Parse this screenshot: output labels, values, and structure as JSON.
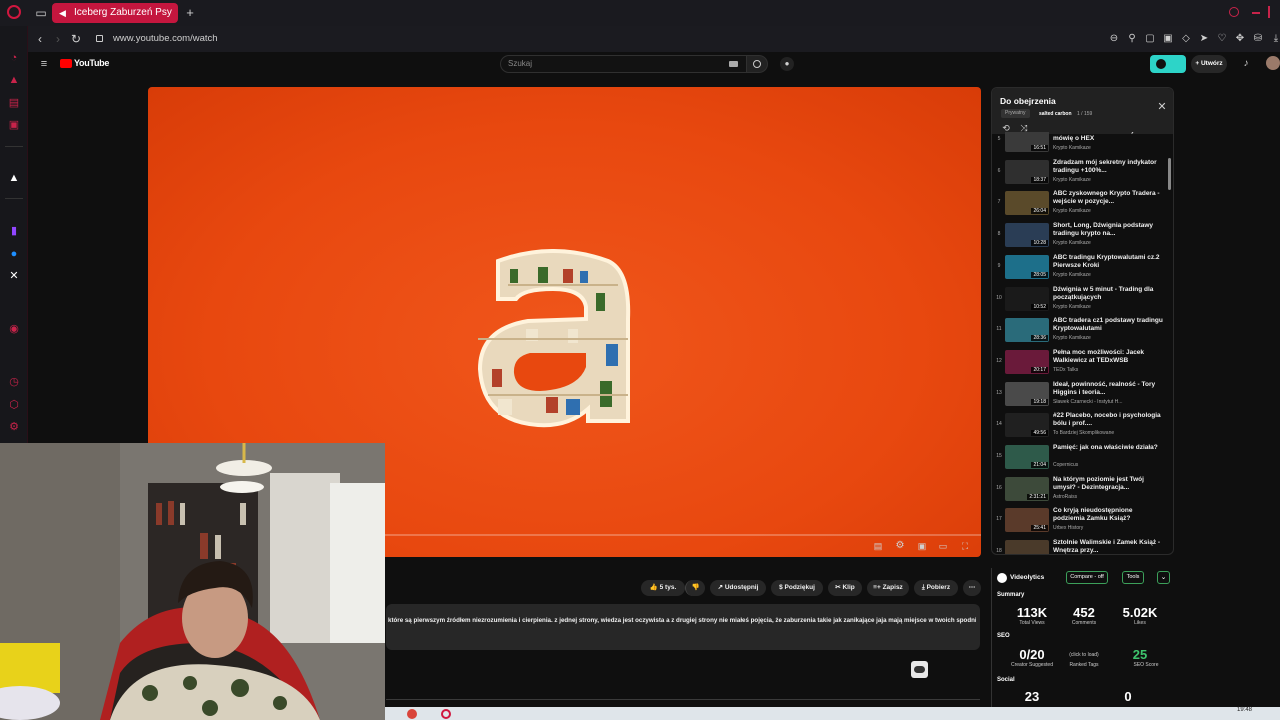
{
  "browser": {
    "tab_title": "Iceberg Zaburzeń Psy",
    "url": "www.youtube.com/watch"
  },
  "youtube": {
    "logo_text": "YouTube",
    "search_placeholder": "Szukaj",
    "create_label": "Utwórz"
  },
  "video": {
    "progress_fraction": 0.23
  },
  "playlist": {
    "title": "Do obejrzenia",
    "privacy": "Prywatny",
    "owner": "salted carbon",
    "position": "1 / 159",
    "items": [
      {
        "num": "5",
        "title": "Mało kto wie o HEX a duży film mówię o HEX",
        "channel": "Krypto Kamikaze",
        "duration": "16:51",
        "color": "#3a3a3a"
      },
      {
        "num": "6",
        "title": "Zdradzam mój sekretny indykator tradingu +100%...",
        "channel": "Krypto Kamikaze",
        "duration": "18:37",
        "color": "#2f2f2f"
      },
      {
        "num": "7",
        "title": "ABC zyskownego Krypto Tradera - wejście w pozycje...",
        "channel": "Krypto Kamikaze",
        "duration": "26:04",
        "color": "#5a4a2a"
      },
      {
        "num": "8",
        "title": "Short, Long, Dźwignia podstawy tradingu krypto na...",
        "channel": "Krypto Kamikaze",
        "duration": "10:28",
        "color": "#2a3d55"
      },
      {
        "num": "9",
        "title": "ABC tradingu Kryptowalutami cz.2 Pierwsze Kroki",
        "channel": "Krypto Kamikaze",
        "duration": "28:05",
        "color": "#1d6f8a"
      },
      {
        "num": "10",
        "title": "Dźwignia w 5 minut - Trading dla początkujących",
        "channel": "Krypto Kamikaze",
        "duration": "10:52",
        "color": "#1a1a1a"
      },
      {
        "num": "11",
        "title": "ABC tradera cz1 podstawy tradingu Kryptowalutami",
        "channel": "Krypto Kamikaze",
        "duration": "28:36",
        "color": "#2a6b7a"
      },
      {
        "num": "12",
        "title": "Pełna moc możliwości: Jacek Walkiewicz at TEDxWSB",
        "channel": "TEDx Talks",
        "duration": "20:17",
        "color": "#6a1a3a"
      },
      {
        "num": "13",
        "title": "Ideał, powinność, realność - Tory Higgins i teoria...",
        "channel": "Sławek Czarnecki - Instytut H...",
        "duration": "19:18",
        "color": "#4a4a4a"
      },
      {
        "num": "14",
        "title": "#22 Placebo, nocebo i psychologia bólu i prof....",
        "channel": "To Bardziej Skomplikowane",
        "duration": "49:56",
        "color": "#202020"
      },
      {
        "num": "15",
        "title": "Pamięć: jak ona właściwie działa?",
        "channel": "Copernicus",
        "duration": "21:04",
        "color": "#2e5a4a"
      },
      {
        "num": "16",
        "title": "Na którym poziomie jest Twój umysł? - Dezintegracja...",
        "channel": "AstroRaiss",
        "duration": "2:31:21",
        "color": "#3d4a3a"
      },
      {
        "num": "17",
        "title": "Co kryją nieudostępnione podziemia Zamku Książ?",
        "channel": "Urbex History",
        "duration": "25:41",
        "color": "#5a3a2a"
      },
      {
        "num": "18",
        "title": "Sztolnie Walimskie i Zamek Książ - Wnętrza przy...",
        "channel": "",
        "duration": "",
        "color": "#4a3a2a"
      }
    ]
  },
  "actions": {
    "likes": "5 tys.",
    "share": "Udostępnij",
    "thanks": "Podziękuj",
    "clip": "Klip",
    "save": "Zapisz",
    "download": "Pobierz"
  },
  "description": {
    "text": "które są pierwszym źródłem niezrozumienia i cierpienia.  z jednej strony, wiedza  jest oczywista a z drugiej strony nie miałeś pojęcia, że zaburzenia takie jak zanikające jaja mają miejsce w twoich spodniach."
  },
  "videolytics": {
    "brand": "Videolytics",
    "compare_label": "Compare - off",
    "tools_label": "Tools",
    "summary_label": "Summary",
    "total_views": "113K",
    "total_views_label": "Total Views",
    "comments": "452",
    "comments_label": "Comments",
    "likes": "5.02K",
    "likes_label": "Likes",
    "seo_label": "SEO",
    "creator_suggested": "0/20",
    "creator_suggested_label": "Creator Suggested",
    "ranked_tags_hint": "(click to load)",
    "ranked_tags_label": "Ranked Tags",
    "seo_score": "25",
    "seo_score_label": "SEO Score",
    "social_label": "Social",
    "social_a": "23",
    "social_b": "0"
  },
  "taskbar": {
    "time": "19:48"
  }
}
